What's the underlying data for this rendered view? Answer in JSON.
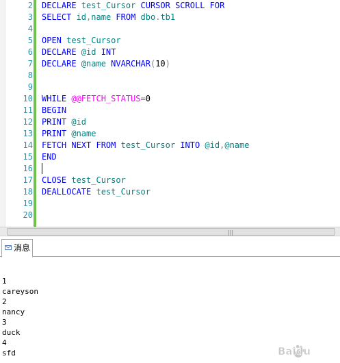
{
  "editor": {
    "line_numbers": [
      "2",
      "3",
      "4",
      "5",
      "6",
      "7",
      "8",
      "9",
      "10",
      "11",
      "12",
      "13",
      "14",
      "15",
      "16",
      "17",
      "18",
      "19",
      "20"
    ],
    "code": {
      "l2": {
        "a": "DECLARE",
        "b": " test_Cursor ",
        "c": "CURSOR SCROLL FOR"
      },
      "l3": {
        "a": "SELECT",
        "b": " id",
        "c": ",",
        "d": "name ",
        "e": "FROM",
        "f": " dbo",
        "g": ".",
        "h": "tb1"
      },
      "l5": {
        "a": "OPEN",
        "b": " test_Cursor"
      },
      "l6": {
        "a": "DECLARE",
        "b": " @id ",
        "c": "INT"
      },
      "l7": {
        "a": "DECLARE",
        "b": " @name ",
        "c": "NVARCHAR",
        "d": "(",
        "e": "10",
        "f": ")"
      },
      "l10": {
        "a": "WHILE",
        "b": " ",
        "c": "@@FETCH_STATUS",
        "d": "=",
        "e": "0"
      },
      "l11": {
        "a": "BEGIN"
      },
      "l12": {
        "a": "PRINT",
        "b": " @id"
      },
      "l13": {
        "a": "PRINT",
        "b": " @name"
      },
      "l14": {
        "a": "FETCH NEXT FROM",
        "b": " test_Cursor ",
        "c": "INTO",
        "d": " @id",
        "e": ",",
        "f": "@name"
      },
      "l15": {
        "a": "END"
      },
      "l17": {
        "a": "CLOSE",
        "b": " test_Cursor"
      },
      "l18": {
        "a": "DEALLOCATE",
        "b": " test_Cursor"
      }
    }
  },
  "scrollbar": {
    "grip": "|||"
  },
  "results": {
    "tab_label": "消息",
    "tab_icon": "message-icon",
    "output_lines": [
      "1",
      "careyson",
      "2",
      "nancy",
      "3",
      "duck",
      "4",
      "sfd"
    ]
  },
  "watermark": {
    "text": "Baidu 经验",
    "icon": "baidu-paw-icon"
  },
  "colors": {
    "keyword": "#0000ff",
    "system_function": "#ff00ff",
    "identifier": "#008080",
    "operator": "#808080",
    "line_number": "#2b91af",
    "change_bar": "#6cc24a"
  }
}
